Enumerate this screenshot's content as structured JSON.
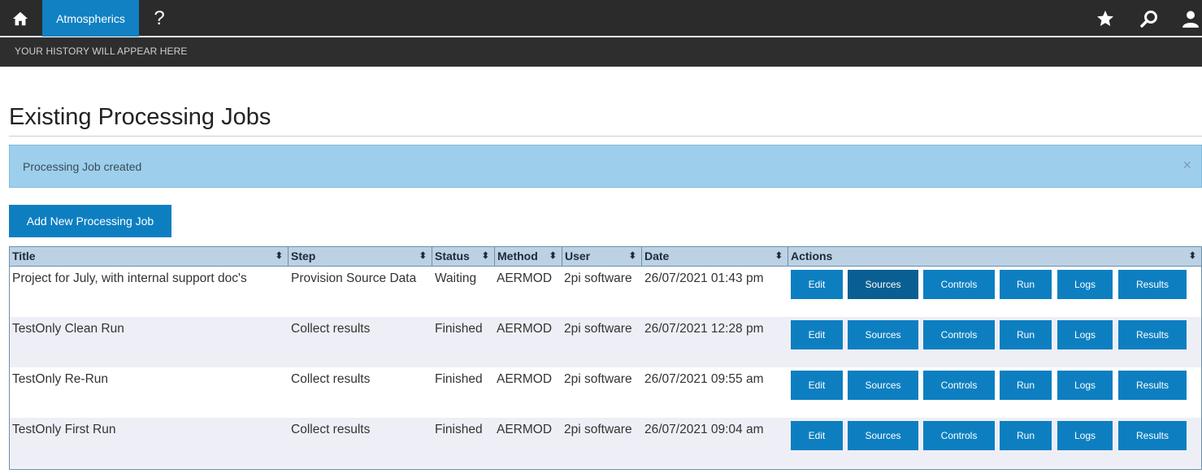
{
  "nav": {
    "active_tab": "Atmospherics",
    "help_label": "?"
  },
  "history": {
    "text": "YOUR HISTORY WILL APPEAR HERE"
  },
  "page": {
    "title": "Existing Processing Jobs"
  },
  "alert": {
    "message": "Processing Job created",
    "close": "×"
  },
  "toolbar": {
    "add_label": "Add New Processing Job"
  },
  "table": {
    "headers": [
      "Title",
      "Step",
      "Status",
      "Method",
      "User",
      "Date",
      "Actions"
    ],
    "sort_glyph": "⬍",
    "action_labels": [
      "Edit",
      "Sources",
      "Controls",
      "Run",
      "Logs",
      "Results"
    ],
    "rows": [
      {
        "title": "Project for July, with internal support doc's",
        "step": "Provision Source Data",
        "status": "Waiting",
        "method": "AERMOD",
        "user": "2pi software",
        "date": "26/07/2021 01:43 pm"
      },
      {
        "title": "TestOnly Clean Run",
        "step": "Collect results",
        "status": "Finished",
        "method": "AERMOD",
        "user": "2pi software",
        "date": "26/07/2021 12:28 pm"
      },
      {
        "title": "TestOnly Re-Run",
        "step": "Collect results",
        "status": "Finished",
        "method": "AERMOD",
        "user": "2pi software",
        "date": "26/07/2021 09:55 am"
      },
      {
        "title": "TestOnly First Run",
        "step": "Collect results",
        "status": "Finished",
        "method": "AERMOD",
        "user": "2pi software",
        "date": "26/07/2021 09:04 am"
      }
    ]
  },
  "colors": {
    "accent": "#1181c3",
    "nav_bg": "#2b2b2b",
    "alert_bg": "#9dcfec",
    "header_bg": "#bcd2e4"
  },
  "icons": {
    "home": "home-icon",
    "star": "star-icon",
    "search": "search-icon",
    "user": "user-icon"
  }
}
